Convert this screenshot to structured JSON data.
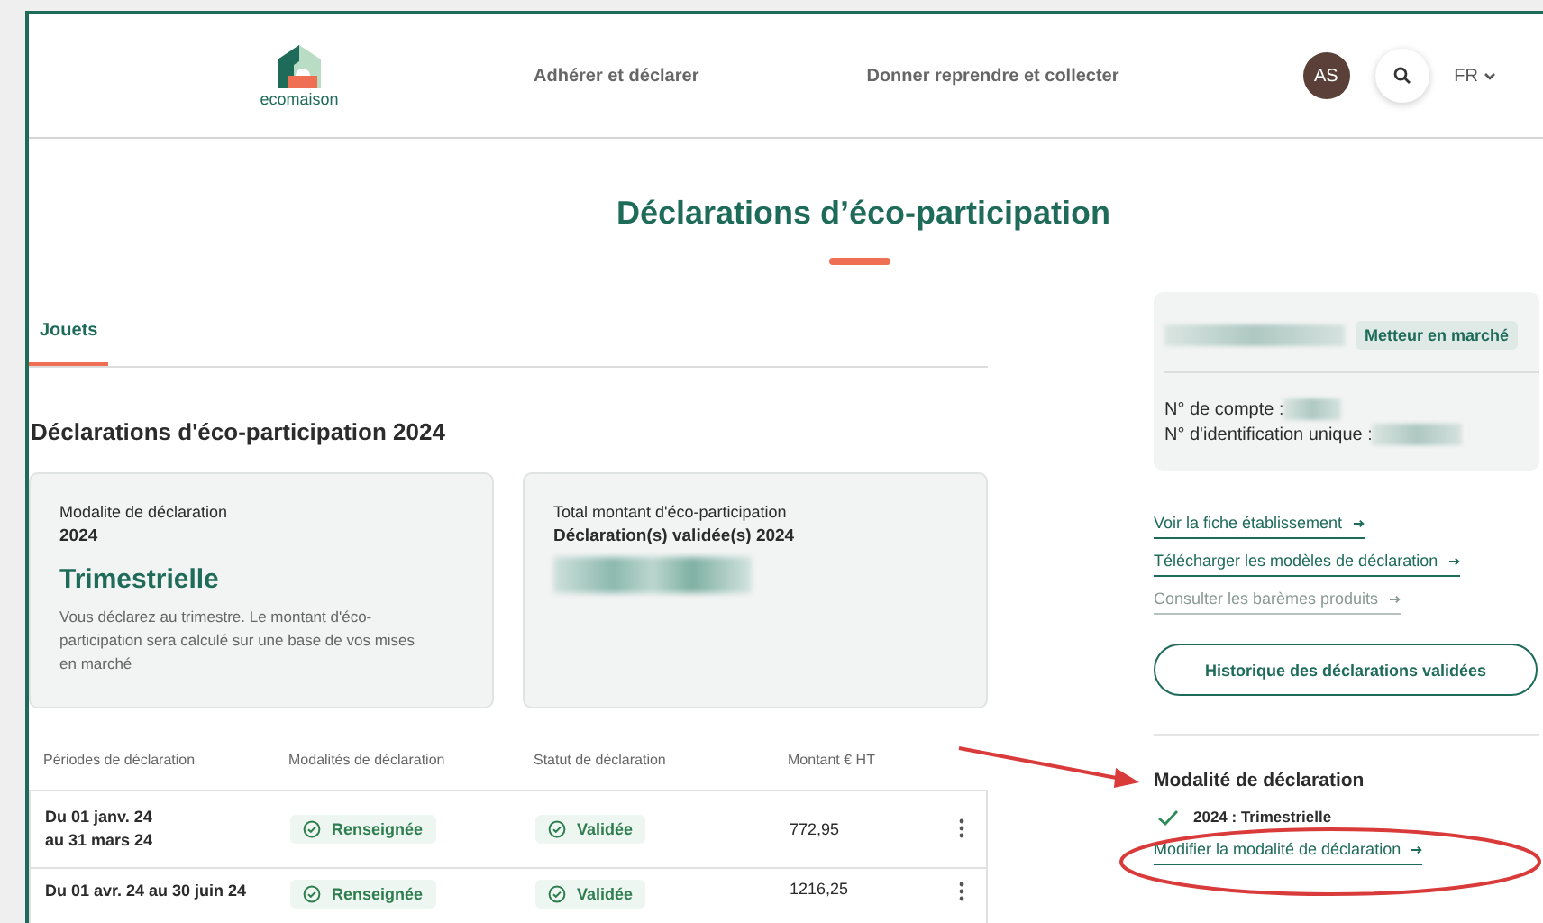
{
  "header": {
    "logo": "ecomaison",
    "nav": [
      "Adhérer et déclarer",
      "Donner reprendre et collecter"
    ],
    "avatar": "AS",
    "language": "FR"
  },
  "page_title": "Déclarations d’éco-participation",
  "tabs": [
    {
      "label": "Jouets",
      "selected": true
    }
  ],
  "section_title": "Déclarations d'éco-participation 2024",
  "cards": [
    {
      "kind": "mode",
      "label": "Modalite de déclaration",
      "year": "2024",
      "value": "Trimestrielle",
      "description": "Vous déclarez au trimestre. Le montant d'éco-participation sera calculé sur une base de vos mises en marché"
    },
    {
      "kind": "total",
      "label": "Total montant d'éco-participation",
      "subtitle": "Déclaration(s) validée(s) 2024"
    }
  ],
  "table": {
    "columns": [
      "Périodes de déclaration",
      "Modalités de déclaration",
      "Statut de déclaration",
      "Montant € HT"
    ],
    "rows": [
      {
        "period": "Du 01 janv. 24\nau 31 mars 24",
        "modality": "Renseignée",
        "status": "Validée",
        "amount": "772,95"
      },
      {
        "period": "Du 01 avr. 24 au 30 juin 24",
        "modality": "Renseignée",
        "status": "Validée",
        "amount": "1216,25"
      }
    ]
  },
  "account": {
    "badge": "Metteur en marché",
    "account_label": "N° de compte :",
    "id_label": "N° d'identification unique :"
  },
  "links": [
    {
      "label": "Voir la fiche établissement",
      "muted": false
    },
    {
      "label": "Télécharger les modèles de déclaration",
      "muted": false
    },
    {
      "label": "Consulter les barèmes produits",
      "muted": true
    }
  ],
  "history_button": "Historique des déclarations validées",
  "modality": {
    "title": "Modalité de déclaration",
    "entry": "2024 : Trimestrielle",
    "link": "Modifier la modalité de déclaration"
  }
}
